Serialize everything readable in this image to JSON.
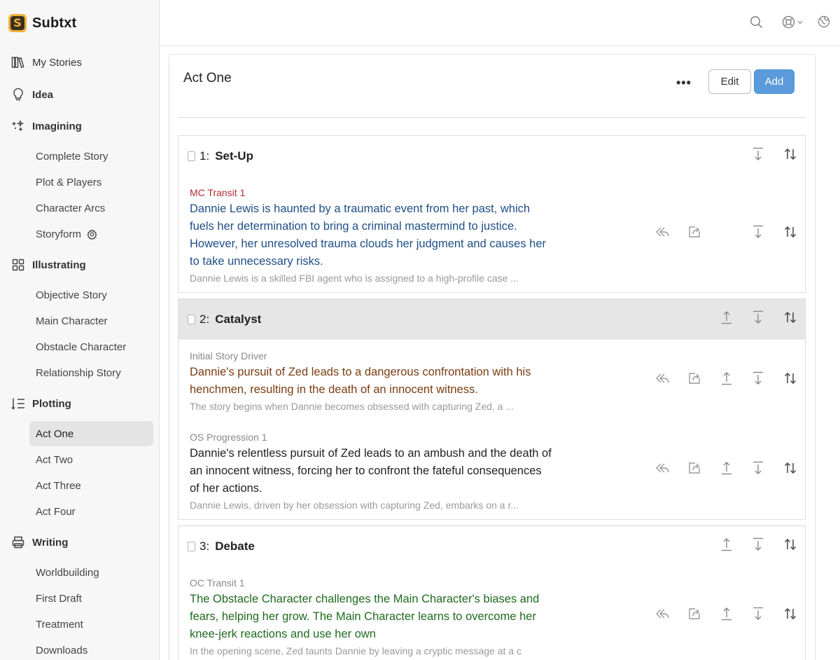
{
  "app": {
    "name": "Subtxt",
    "logo_letter": "S"
  },
  "sidebar": {
    "top_items": [
      {
        "label": "My Stories",
        "icon": "books-icon"
      },
      {
        "label": "Idea",
        "icon": "lightbulb-icon"
      },
      {
        "label": "Imagining",
        "icon": "sparkles-icon"
      },
      {
        "label": "Illustrating",
        "icon": "grid-icon"
      },
      {
        "label": "Plotting",
        "icon": "list-ordered-icon"
      },
      {
        "label": "Writing",
        "icon": "printer-icon"
      }
    ],
    "imagining": [
      "Complete Story",
      "Plot & Players",
      "Character Arcs",
      "Storyform"
    ],
    "illustrating": [
      "Objective Story",
      "Main Character",
      "Obstacle Character",
      "Relationship Story"
    ],
    "plotting": [
      "Act One",
      "Act Two",
      "Act Three",
      "Act Four"
    ],
    "writing": [
      "Worldbuilding",
      "First Draft",
      "Treatment",
      "Downloads"
    ],
    "active": "Act One"
  },
  "main": {
    "title": "Act One",
    "more_label": "•••",
    "edit_label": "Edit",
    "add_label": "Add"
  },
  "sequences": [
    {
      "number": "1:",
      "name": "Set-Up",
      "beats": [
        {
          "label": "MC Transit 1",
          "text": "Dannie Lewis is haunted by a traumatic event from her past, which fuels her determination to bring a criminal mastermind to justice. However, her unresolved trauma clouds her judgment and causes her to take unnecessary risks.",
          "summary": "Dannie Lewis is a skilled FBI agent who is assigned to a high-profile case ..."
        }
      ]
    },
    {
      "number": "2:",
      "name": "Catalyst",
      "beats": [
        {
          "label": "Initial Story Driver",
          "text": "Dannie's pursuit of Zed leads to a dangerous confrontation with his henchmen, resulting in the death of an innocent witness.",
          "summary": "The story begins when Dannie becomes obsessed with capturing Zed, a ..."
        },
        {
          "label": "OS Progression 1",
          "text": "Dannie's relentless pursuit of Zed leads to an ambush and the death of an innocent witness, forcing her to confront the fateful consequences of her actions.",
          "summary": "Dannie Lewis, driven by her obsession with capturing Zed, embarks on a r..."
        }
      ]
    },
    {
      "number": "3:",
      "name": "Debate",
      "beats": [
        {
          "label": "OC Transit 1",
          "text": "The Obstacle Character challenges the Main Character's biases and fears, helping her grow. The Main Character learns to overcome her knee-jerk reactions and use her own",
          "summary": "In the opening scene, Zed taunts Dannie by leaving a cryptic message at a c"
        }
      ]
    }
  ],
  "colors": {
    "mc_label": "#b03030",
    "mc_text": "#1f4f86",
    "driver_text": "#7a3d12",
    "os_text": "#222222",
    "oc_text": "#1f6b1f",
    "accent": "#5b9bdc"
  }
}
